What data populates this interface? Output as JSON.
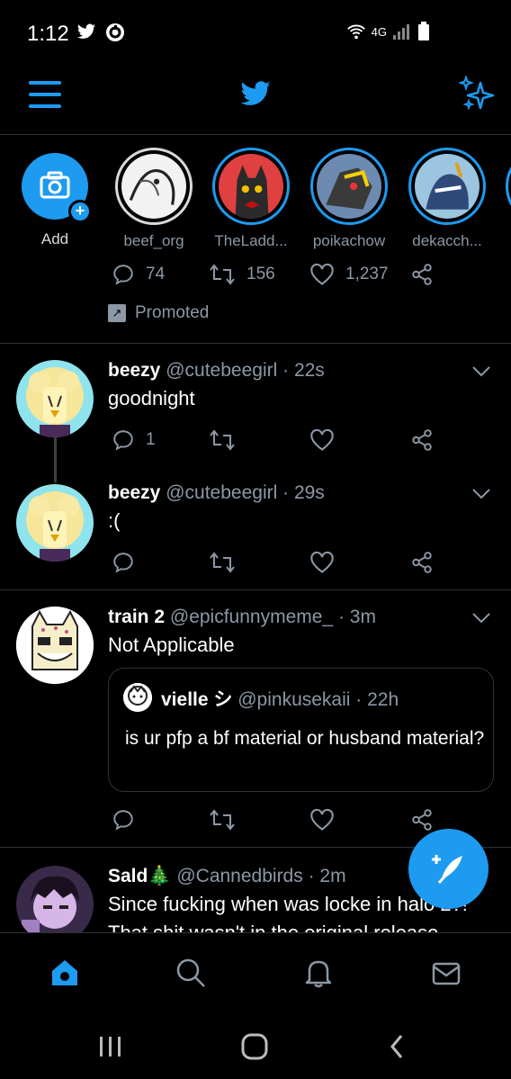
{
  "status_bar": {
    "time": "1:12",
    "network_label": "4G"
  },
  "fleets": [
    {
      "label": "Add"
    },
    {
      "label": "beef_org"
    },
    {
      "label": "TheLadd..."
    },
    {
      "label": "poikachow"
    },
    {
      "label": "dekacch..."
    }
  ],
  "promoted_tweet": {
    "replies": "74",
    "retweets": "156",
    "likes": "1,237",
    "promoted_label": "Promoted"
  },
  "tweets": [
    {
      "name": "beezy",
      "handle": "@cutebeegirl",
      "time": "· 22s",
      "text": "goodnight",
      "replies": "1"
    },
    {
      "name": "beezy",
      "handle": "@cutebeegirl",
      "time": "· 29s",
      "text": ":("
    },
    {
      "name": "train 2",
      "handle": "@epicfunnymeme_",
      "time": "· 3m",
      "text": "Not Applicable",
      "quote": {
        "name": "vielle シ",
        "handle": "@pinkusekaii",
        "time": "· 22h",
        "text": "is ur pfp a bf material or husband material?"
      }
    },
    {
      "name": "Sald🎄",
      "handle": "@Cannedbirds",
      "time": "· 2m",
      "text": "Since fucking when was locke in halo 2?!",
      "text_partial": "That shit wasn't in the original release"
    }
  ],
  "colors": {
    "accent": "#1d9bf0",
    "background": "#000000",
    "muted": "#8b98a5",
    "divider": "#2f3336"
  }
}
